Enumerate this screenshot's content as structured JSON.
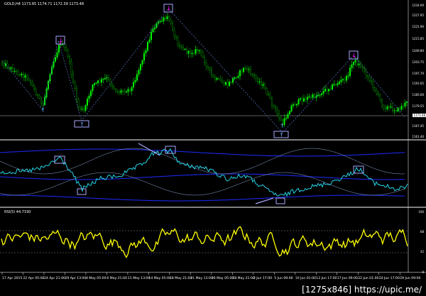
{
  "main": {
    "title": "GOLD,H4  1173.65 1174.71 1172.39 1173.48",
    "price_axis": [
      "1234.00",
      "1227.95",
      "1221.90",
      "1215.85",
      "1209.80",
      "1203.75",
      "1197.70",
      "1191.65",
      "1185.60",
      "1179.55",
      "1167.45",
      "1161.40"
    ],
    "current_price": "1173.48"
  },
  "rsi": {
    "title": "RSI(5) 44.7330",
    "levels": [
      "100",
      "68",
      "32",
      "0"
    ]
  },
  "dates": [
    "17 Apr 2015",
    "22 Apr 05:00",
    "24 Apr 21:00",
    "29 Apr 13:00",
    "4 May 05:00",
    "6 May 21:00",
    "11 May 13:00",
    "14 May 05:00",
    "18 May 21:00",
    "21 May 13:00",
    "26 May 05:00",
    "28 May 21:00",
    "2 Jun 17:00",
    "5 Jun 09:00",
    "10 Jun 01:00",
    "12 Jun 17:00",
    "17 Jun 09:00",
    "22 Jun 01:00",
    "24 Jun 17:00",
    "29 Jun 09:00"
  ],
  "watermark": "[1275x846] https://upic.me/",
  "colors": {
    "bull": "#00ff00",
    "bear": "#00a000",
    "zig": "#4f6fb0",
    "signal": "#a9a9ff",
    "cyan": "#22d3e8",
    "band": "#1e2aff",
    "rsi": "#ffff00",
    "up_arrow": "#6aa7ff",
    "down_arrow": "#ff00ff"
  }
}
